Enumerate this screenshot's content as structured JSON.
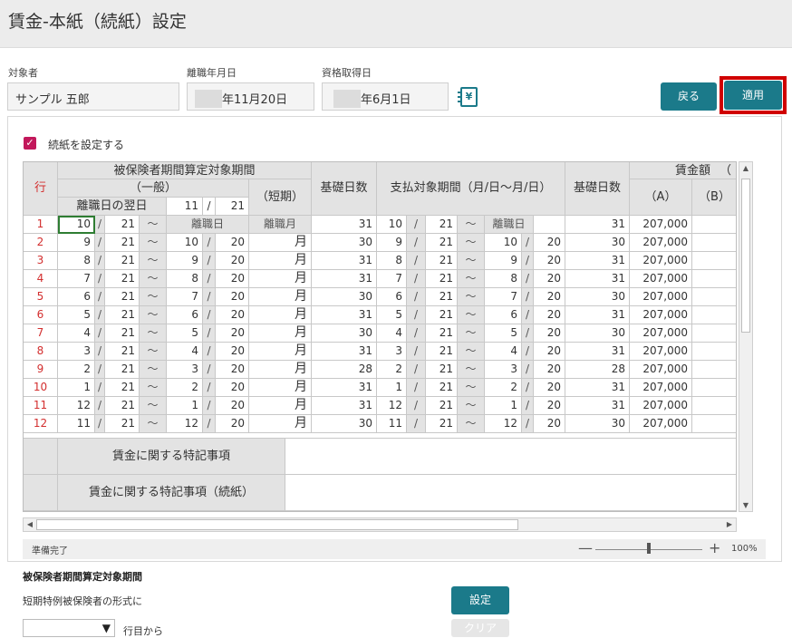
{
  "title": "賃金-本紙（続紙）設定",
  "fields": {
    "target_label": "対象者",
    "target_value": "サンプル 五郎",
    "leave_date_label": "離職年月日",
    "leave_date_value": "年11月20日",
    "acquire_date_label": "資格取得日",
    "acquire_date_value": "年6月1日"
  },
  "buttons": {
    "back": "戻る",
    "apply": "適用",
    "set": "設定",
    "clear": "クリア"
  },
  "ledger_icon_glyph": "¥",
  "checkbox": {
    "label": "続紙を設定する",
    "checked": true,
    "mark": "✓"
  },
  "headers": {
    "row": "行",
    "insured_period": "被保険者期間算定対象期間",
    "general": "（一般）",
    "next_day": "離職日の翌日",
    "next_day_month": "11",
    "next_day_sep": "/",
    "next_day_day": "21",
    "short_term": "（短期）",
    "base_days": "基礎日数",
    "pay_period": "支払対象期間（月/日〜月/日）",
    "base_days2": "基礎日数",
    "wage": "賃金額",
    "wage_paren": "（",
    "col_a": "（A）",
    "col_b": "（B）"
  },
  "first_row": {
    "leave_day": "離職日",
    "leave_month": "離職月",
    "pay_leave_day": "離職日"
  },
  "rows": [
    {
      "no": "1",
      "fm": "10",
      "fd": "21",
      "tm": "",
      "td": "",
      "short": "離職月",
      "bd": "31",
      "pfm": "10",
      "pfd": "21",
      "ptm": "",
      "ptd": "",
      "bd2": "31",
      "a": "207,000",
      "b": ""
    },
    {
      "no": "2",
      "fm": "9",
      "fd": "21",
      "tm": "10",
      "td": "20",
      "short": "月",
      "bd": "30",
      "pfm": "9",
      "pfd": "21",
      "ptm": "10",
      "ptd": "20",
      "bd2": "30",
      "a": "207,000",
      "b": ""
    },
    {
      "no": "3",
      "fm": "8",
      "fd": "21",
      "tm": "9",
      "td": "20",
      "short": "月",
      "bd": "31",
      "pfm": "8",
      "pfd": "21",
      "ptm": "9",
      "ptd": "20",
      "bd2": "31",
      "a": "207,000",
      "b": ""
    },
    {
      "no": "4",
      "fm": "7",
      "fd": "21",
      "tm": "8",
      "td": "20",
      "short": "月",
      "bd": "31",
      "pfm": "7",
      "pfd": "21",
      "ptm": "8",
      "ptd": "20",
      "bd2": "31",
      "a": "207,000",
      "b": ""
    },
    {
      "no": "5",
      "fm": "6",
      "fd": "21",
      "tm": "7",
      "td": "20",
      "short": "月",
      "bd": "30",
      "pfm": "6",
      "pfd": "21",
      "ptm": "7",
      "ptd": "20",
      "bd2": "30",
      "a": "207,000",
      "b": ""
    },
    {
      "no": "6",
      "fm": "5",
      "fd": "21",
      "tm": "6",
      "td": "20",
      "short": "月",
      "bd": "31",
      "pfm": "5",
      "pfd": "21",
      "ptm": "6",
      "ptd": "20",
      "bd2": "31",
      "a": "207,000",
      "b": ""
    },
    {
      "no": "7",
      "fm": "4",
      "fd": "21",
      "tm": "5",
      "td": "20",
      "short": "月",
      "bd": "30",
      "pfm": "4",
      "pfd": "21",
      "ptm": "5",
      "ptd": "20",
      "bd2": "30",
      "a": "207,000",
      "b": ""
    },
    {
      "no": "8",
      "fm": "3",
      "fd": "21",
      "tm": "4",
      "td": "20",
      "short": "月",
      "bd": "31",
      "pfm": "3",
      "pfd": "21",
      "ptm": "4",
      "ptd": "20",
      "bd2": "31",
      "a": "207,000",
      "b": ""
    },
    {
      "no": "9",
      "fm": "2",
      "fd": "21",
      "tm": "3",
      "td": "20",
      "short": "月",
      "bd": "28",
      "pfm": "2",
      "pfd": "21",
      "ptm": "3",
      "ptd": "20",
      "bd2": "28",
      "a": "207,000",
      "b": ""
    },
    {
      "no": "10",
      "fm": "1",
      "fd": "21",
      "tm": "2",
      "td": "20",
      "short": "月",
      "bd": "31",
      "pfm": "1",
      "pfd": "21",
      "ptm": "2",
      "ptd": "20",
      "bd2": "31",
      "a": "207,000",
      "b": ""
    },
    {
      "no": "11",
      "fm": "12",
      "fd": "21",
      "tm": "1",
      "td": "20",
      "short": "月",
      "bd": "31",
      "pfm": "12",
      "pfd": "21",
      "ptm": "1",
      "ptd": "20",
      "bd2": "31",
      "a": "207,000",
      "b": ""
    },
    {
      "no": "12",
      "fm": "11",
      "fd": "21",
      "tm": "12",
      "td": "20",
      "short": "月",
      "bd": "30",
      "pfm": "11",
      "pfd": "21",
      "ptm": "12",
      "ptd": "20",
      "bd2": "30",
      "a": "207,000",
      "b": ""
    }
  ],
  "symbols": {
    "slash": "/",
    "tilde": "〜"
  },
  "memo": {
    "label1": "賃金に関する特記事項",
    "label2": "賃金に関する特記事項（続紙）"
  },
  "status": {
    "text": "準備完了",
    "zoom": "100%",
    "zoom_minus": "—",
    "zoom_plus": "+"
  },
  "section": {
    "title": "被保険者期間算定対象期間",
    "text": "短期特例被保険者の形式に",
    "dropdown_arrow": "▼",
    "row_from": "行目から"
  },
  "scroll": {
    "up": "▲",
    "down": "▼",
    "left": "◀",
    "right": "▶"
  },
  "colors": {
    "accent": "#1b7a8a",
    "highlight": "#d00000",
    "row_number": "#d32f2f",
    "checkbox": "#c2185b"
  }
}
